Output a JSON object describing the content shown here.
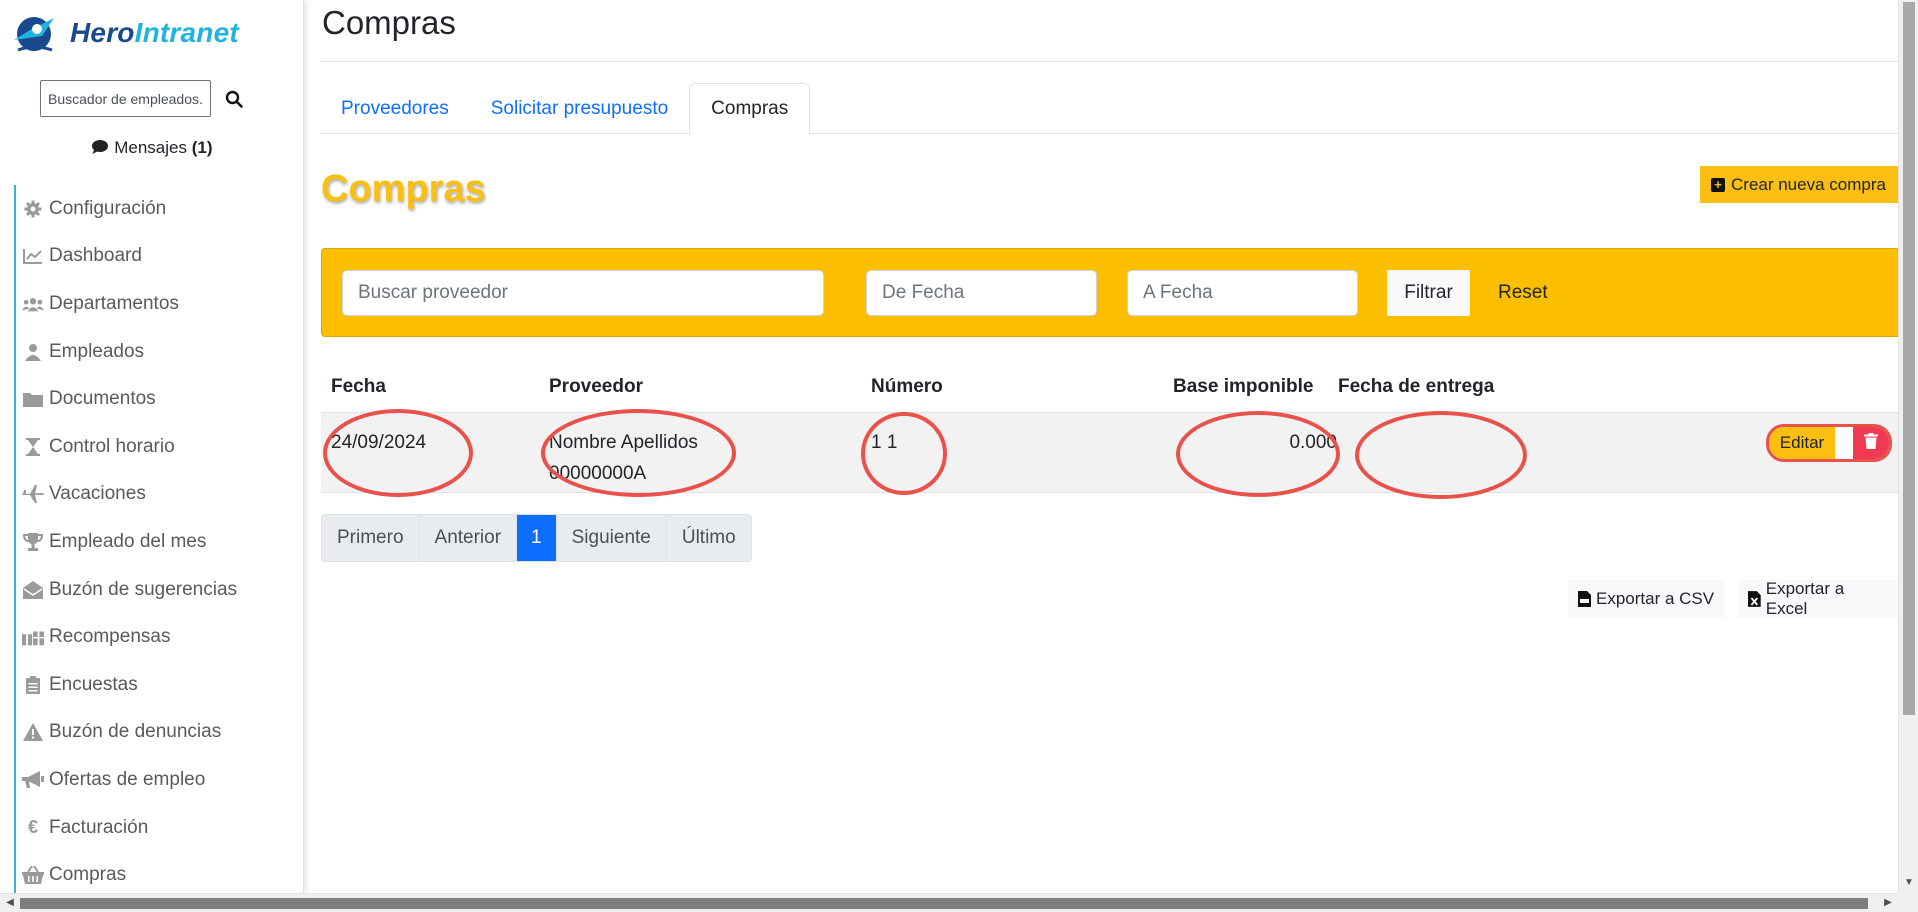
{
  "brand": {
    "part1": "Hero",
    "part2": "Intranet",
    "logo_icon": "hero-mascot-logo"
  },
  "sidebar": {
    "search_placeholder": "Buscador de empleados...",
    "messages_label": "Mensajes",
    "messages_count": "(1)",
    "items": [
      {
        "label": "Configuración",
        "icon": "gear-icon"
      },
      {
        "label": "Dashboard",
        "icon": "chart-line-icon"
      },
      {
        "label": "Departamentos",
        "icon": "users-icon"
      },
      {
        "label": "Empleados",
        "icon": "user-icon"
      },
      {
        "label": "Documentos",
        "icon": "folder-icon"
      },
      {
        "label": "Control horario",
        "icon": "hourglass-icon"
      },
      {
        "label": "Vacaciones",
        "icon": "plane-icon"
      },
      {
        "label": "Empleado del mes",
        "icon": "trophy-icon"
      },
      {
        "label": "Buzón de sugerencias",
        "icon": "envelope-open-icon"
      },
      {
        "label": "Recompensas",
        "icon": "gifts-icon"
      },
      {
        "label": "Encuestas",
        "icon": "clipboard-list-icon"
      },
      {
        "label": "Buzón de denuncias",
        "icon": "warning-icon"
      },
      {
        "label": "Ofertas de empleo",
        "icon": "bullhorn-icon"
      },
      {
        "label": "Facturación",
        "icon": "euro-icon"
      },
      {
        "label": "Compras",
        "icon": "basket-icon"
      }
    ]
  },
  "page": {
    "title": "Compras",
    "tabs": [
      {
        "label": "Proveedores",
        "active": false
      },
      {
        "label": "Solicitar presupuesto",
        "active": false
      },
      {
        "label": "Compras",
        "active": true
      }
    ],
    "section_title": "Compras",
    "create_button": "Crear nueva compra"
  },
  "filters": {
    "provider_placeholder": "Buscar proveedor",
    "from_date_placeholder": "De Fecha",
    "to_date_placeholder": "A Fecha",
    "filter_button": "Filtrar",
    "reset_button": "Reset"
  },
  "table": {
    "headers": [
      "Fecha",
      "Proveedor",
      "Número",
      "Base imponible",
      "Fecha de entrega"
    ],
    "rows": [
      {
        "fecha": "24/09/2024",
        "proveedor_line1": "Nombre Apellidos",
        "proveedor_line2": "00000000A",
        "numero": "1 1",
        "base": "0.000",
        "entrega": ""
      }
    ],
    "edit_button": "Editar"
  },
  "pagination": {
    "first": "Primero",
    "prev": "Anterior",
    "current": "1",
    "next": "Siguiente",
    "last": "Último"
  },
  "export": {
    "csv": "Exportar a CSV",
    "excel": "Exportar a Excel"
  },
  "colors": {
    "accent_yellow": "#fbbf12",
    "link_blue": "#0d6efd",
    "danger_red": "#f03a52",
    "annotation_red": "#e8524a"
  }
}
